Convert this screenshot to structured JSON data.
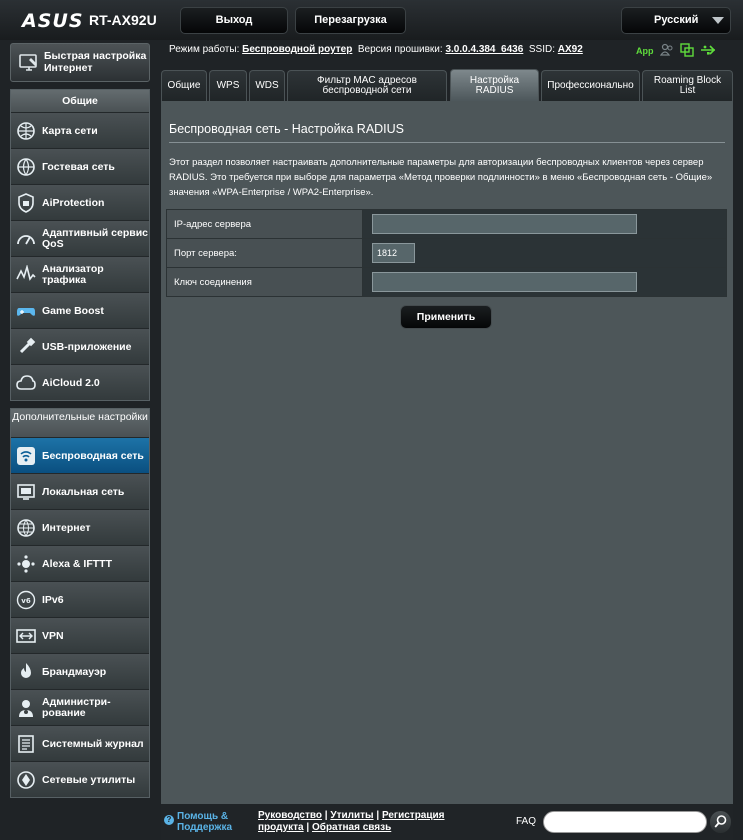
{
  "header": {
    "logo": "ASUS",
    "model": "RT-AX92U",
    "logout": "Выход",
    "reboot": "Перезагрузка",
    "language": "Русский"
  },
  "status": {
    "mode_label": "Режим работы:",
    "mode_value": "Беспроводной роутер",
    "fw_label": "Версия прошивки:",
    "fw_value": "3.0.0.4.384_6436",
    "ssid_label": "SSID:",
    "ssid_value": "AX92",
    "app": "App"
  },
  "sidebar": {
    "quick": "Быстрая настройка Интернет",
    "general_title": "Общие",
    "general": [
      {
        "label": "Карта сети",
        "icon": "network-map-icon"
      },
      {
        "label": "Гостевая сеть",
        "icon": "guest-network-icon"
      },
      {
        "label": "AiProtection",
        "icon": "shield-icon"
      },
      {
        "label": "Адаптивный сервис QoS",
        "icon": "qos-icon"
      },
      {
        "label": "Анализатор трафика",
        "icon": "traffic-icon"
      },
      {
        "label": "Game Boost",
        "icon": "gamepad-icon"
      },
      {
        "label": "USB-приложение",
        "icon": "usb-icon"
      },
      {
        "label": "AiCloud 2.0",
        "icon": "cloud-icon"
      }
    ],
    "advanced_title": "Дополнительные настройки",
    "advanced": [
      {
        "label": "Беспроводная сеть",
        "icon": "wireless-icon"
      },
      {
        "label": "Локальная сеть",
        "icon": "lan-icon"
      },
      {
        "label": "Интернет",
        "icon": "globe-icon"
      },
      {
        "label": "Alexa & IFTTT",
        "icon": "alexa-icon"
      },
      {
        "label": "IPv6",
        "icon": "ipv6-icon"
      },
      {
        "label": "VPN",
        "icon": "vpn-icon"
      },
      {
        "label": "Брандмауэр",
        "icon": "firewall-icon"
      },
      {
        "label": "Администри- рование",
        "icon": "admin-icon"
      },
      {
        "label": "Системный журнал",
        "icon": "log-icon"
      },
      {
        "label": "Сетевые утилиты",
        "icon": "tools-icon"
      }
    ]
  },
  "tabs": [
    "Общие",
    "WPS",
    "WDS",
    "Фильтр MAC адресов беспроводной сети",
    "Настройка RADIUS",
    "Профессионально",
    "Roaming Block List"
  ],
  "panel": {
    "title": "Беспроводная сеть - Настройка RADIUS",
    "description": "Этот раздел позволяет настраивать дополнительные параметры для авторизации беспроводных клиентов через сервер RADIUS. Это требуется при выборе для параметра «Метод проверки подлинности» в меню «Беспроводная сеть - Общие» значения «WPA-Enterprise / WPA2-Enterprise».",
    "fields": {
      "ip_label": "IP-адрес сервера",
      "ip_value": "",
      "port_label": "Порт сервера:",
      "port_value": "1812",
      "key_label": "Ключ соединения",
      "key_value": ""
    },
    "apply": "Применить"
  },
  "footer": {
    "help_line1": "Помощь &",
    "help_line2": "Поддержка",
    "manual": "Руководство",
    "utilities": "Утилиты",
    "registration": "Регистрация",
    "registration2": "продукта",
    "feedback": "Обратная связь",
    "faq": "FAQ"
  },
  "colors": {
    "active_menu": "#0a5e96",
    "accent_green": "#5fdc3c",
    "help_blue": "#5ab3e6"
  }
}
